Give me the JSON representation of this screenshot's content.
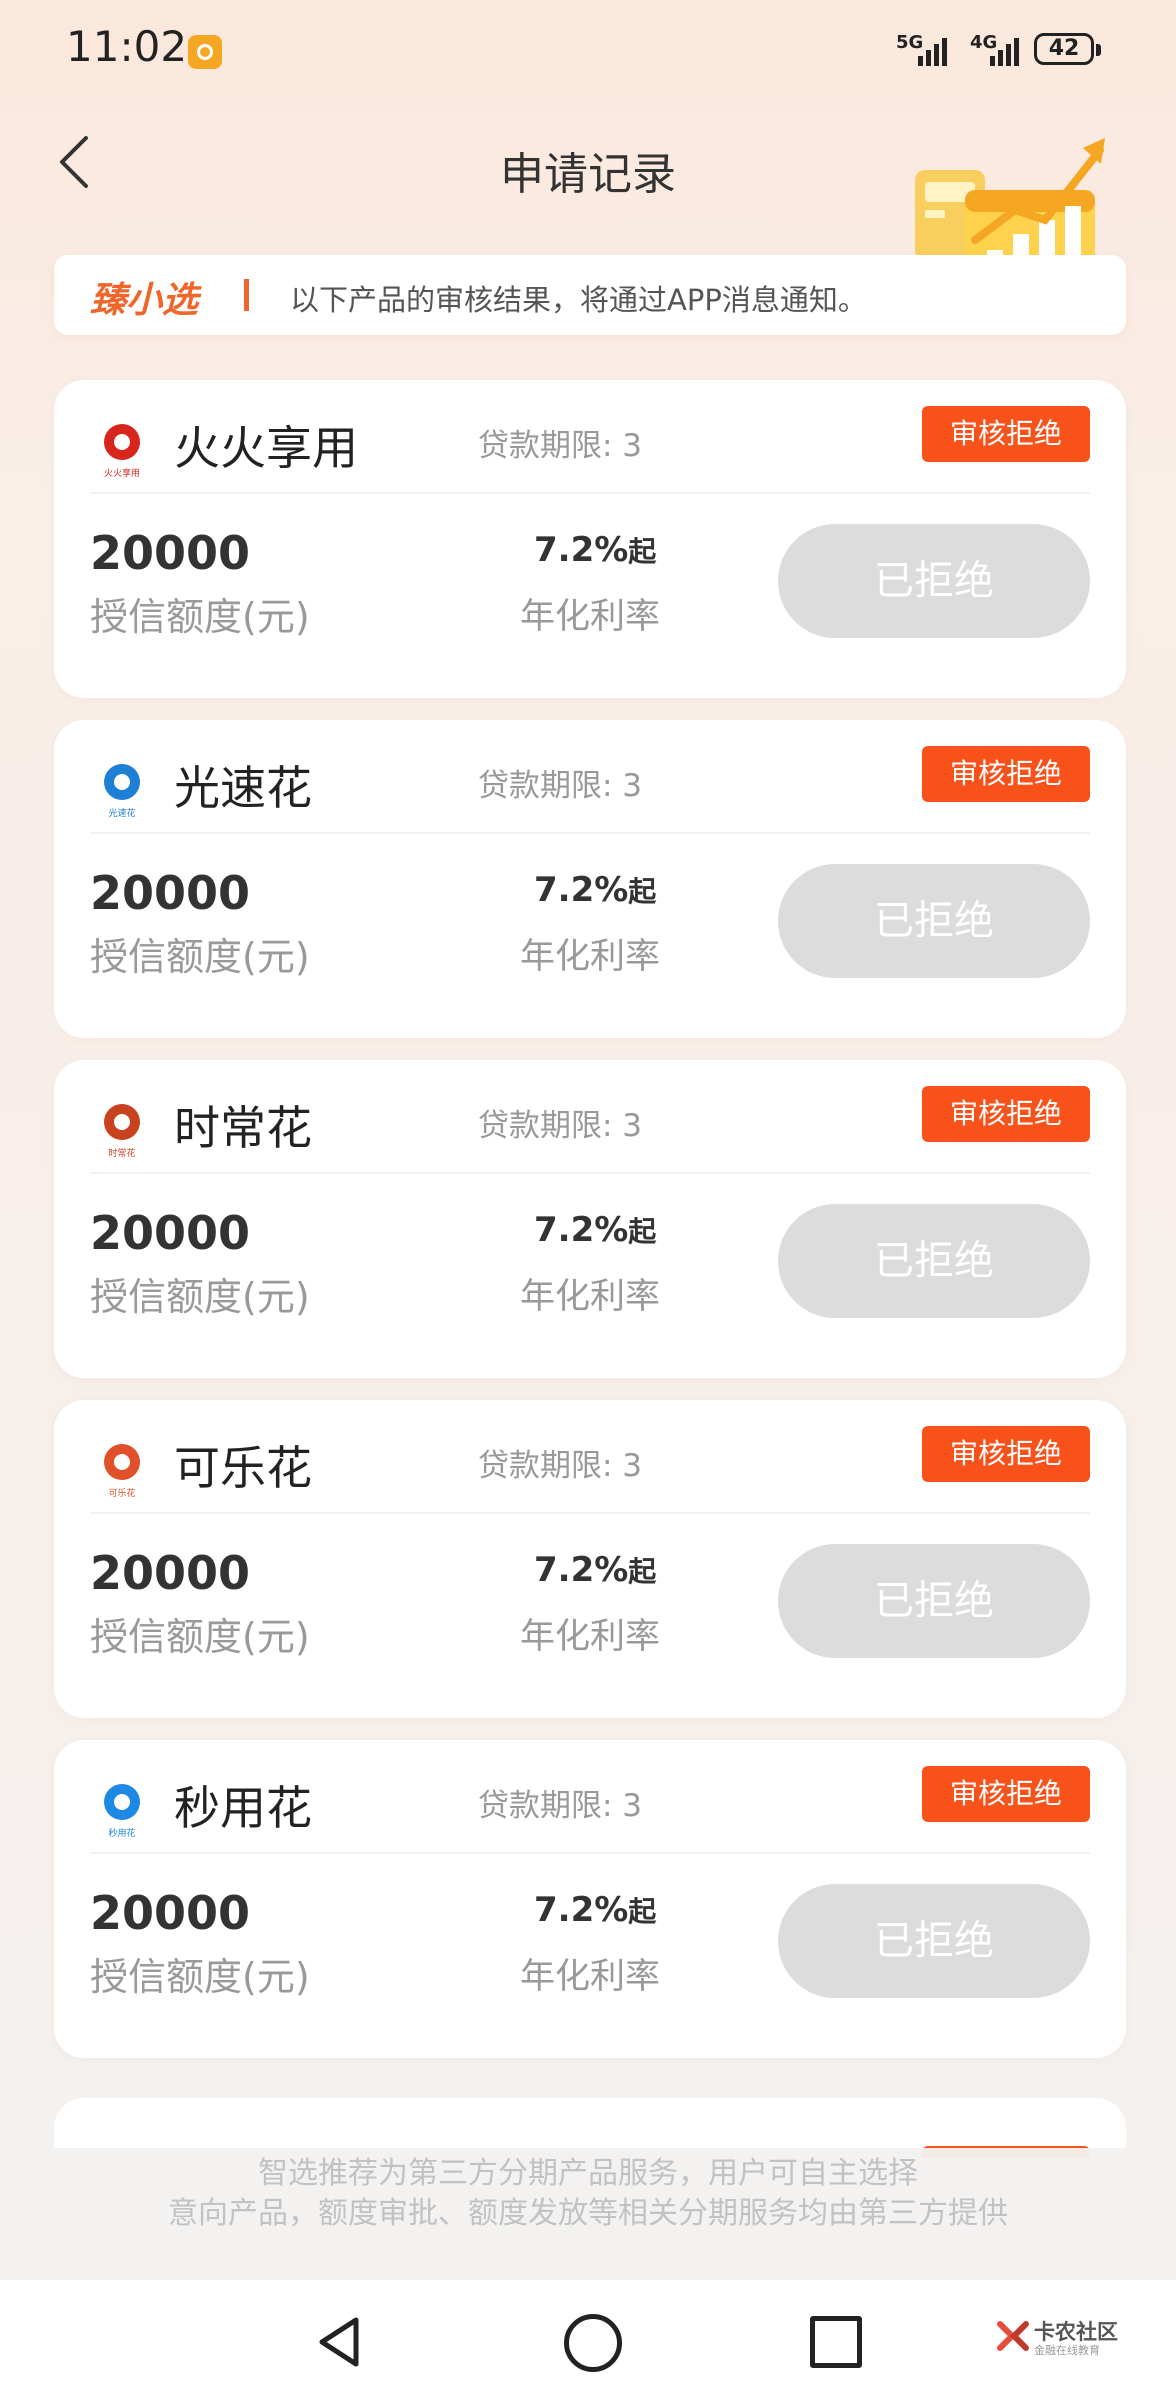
{
  "status_bar": {
    "time": "11:02",
    "network_1": "5G",
    "network_2": "4G",
    "battery": "42"
  },
  "header": {
    "title": "申请记录"
  },
  "notice": {
    "brand": "臻小选",
    "text": "以下产品的审核结果，将通过APP消息通知。"
  },
  "cards": [
    {
      "logo": "火火享用",
      "name": "火火享用",
      "term": "贷款期限: 3",
      "status": "审核拒绝",
      "amount": "20000",
      "amount_label": "授信额度(元)",
      "rate": "7.2%",
      "rate_suffix": "起",
      "rate_label": "年化利率",
      "button": "已拒绝",
      "logo_color": "#d9261c"
    },
    {
      "logo": "光速花",
      "name": "光速花",
      "term": "贷款期限: 3",
      "status": "审核拒绝",
      "amount": "20000",
      "amount_label": "授信额度(元)",
      "rate": "7.2%",
      "rate_suffix": "起",
      "rate_label": "年化利率",
      "button": "已拒绝",
      "logo_color": "#1d7fd6"
    },
    {
      "logo": "时常花",
      "name": "时常花",
      "term": "贷款期限: 3",
      "status": "审核拒绝",
      "amount": "20000",
      "amount_label": "授信额度(元)",
      "rate": "7.2%",
      "rate_suffix": "起",
      "rate_label": "年化利率",
      "button": "已拒绝",
      "logo_color": "#c8421f"
    },
    {
      "logo": "可乐花",
      "name": "可乐花",
      "term": "贷款期限: 3",
      "status": "审核拒绝",
      "amount": "20000",
      "amount_label": "授信额度(元)",
      "rate": "7.2%",
      "rate_suffix": "起",
      "rate_label": "年化利率",
      "button": "已拒绝",
      "logo_color": "#e0502a"
    },
    {
      "logo": "秒用花",
      "name": "秒用花",
      "term": "贷款期限: 3",
      "status": "审核拒绝",
      "amount": "20000",
      "amount_label": "授信额度(元)",
      "rate": "7.2%",
      "rate_suffix": "起",
      "rate_label": "年化利率",
      "button": "已拒绝",
      "logo_color": "#1e88e5"
    }
  ],
  "disclaimer": {
    "line1": "智选推荐为第三方分期产品服务，用户可自主选择",
    "line2": "意向产品，额度审批、额度发放等相关分期服务均由第三方提供"
  },
  "watermark": {
    "text": "卡农社区",
    "sub": "金融在线教育"
  },
  "colors": {
    "accent": "#f85119",
    "brand": "#f0652a",
    "disabled_button": "#dcdcdc"
  }
}
